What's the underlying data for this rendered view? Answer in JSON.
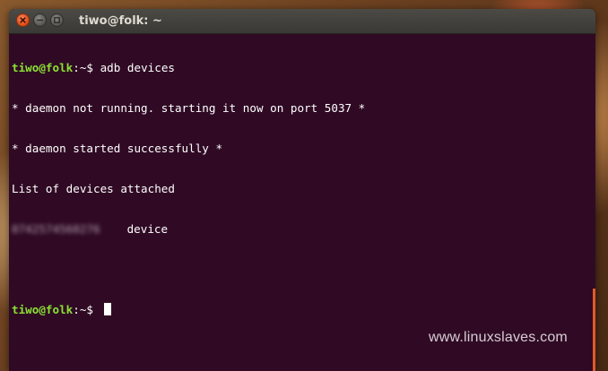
{
  "window": {
    "title": "tiwo@folk: ~"
  },
  "terminal": {
    "lines": [
      {
        "user_host": "tiwo@folk",
        "path": ":~$ ",
        "command": "adb devices"
      },
      {
        "text": "* daemon not running. starting it now on port 5037 *"
      },
      {
        "text": "* daemon started successfully *"
      },
      {
        "text": "List of devices attached"
      },
      {
        "serial": "0742574560276",
        "state": "device"
      },
      {
        "text": ""
      },
      {
        "user_host": "tiwo@folk",
        "path": ":~$ "
      }
    ]
  },
  "watermark": "www.linuxslaves.com",
  "colors": {
    "terminal_bg": "#300a24",
    "prompt": "#8ae234",
    "text": "#ffffff",
    "close_button": "#df4a16"
  }
}
